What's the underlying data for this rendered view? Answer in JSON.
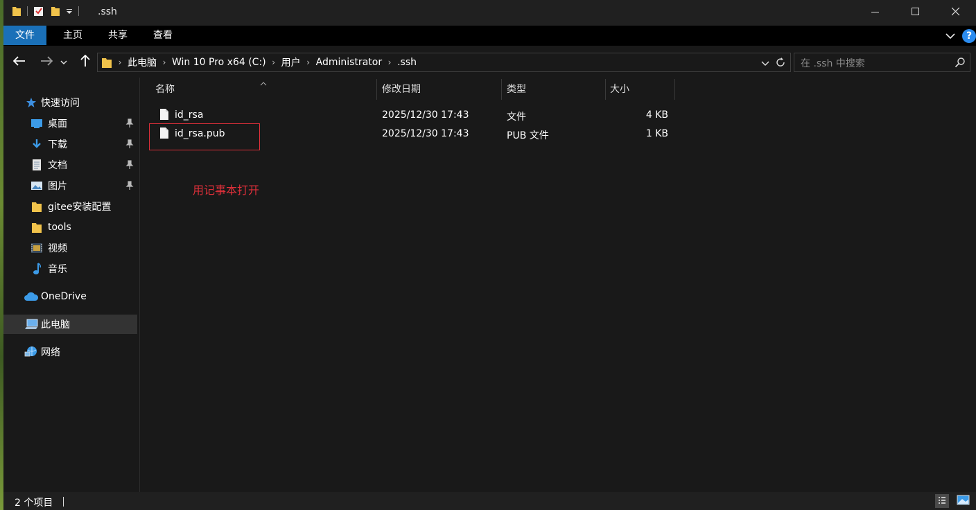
{
  "window": {
    "title": ".ssh",
    "controls": [
      "minimize-icon",
      "maximize-icon",
      "close-icon"
    ]
  },
  "ribbon": {
    "tabs": [
      {
        "label": "文件",
        "active": true
      },
      {
        "label": "主页"
      },
      {
        "label": "共享"
      },
      {
        "label": "查看"
      }
    ]
  },
  "address": {
    "crumbs": [
      "此电脑",
      "Win 10 Pro x64 (C:)",
      "用户",
      "Administrator",
      ".ssh"
    ]
  },
  "search": {
    "placeholder": "在 .ssh 中搜索"
  },
  "nav": {
    "quick_access": "快速访问",
    "items": [
      {
        "label": "桌面",
        "icon": "desktop-icon",
        "pinned": true
      },
      {
        "label": "下载",
        "icon": "download-icon",
        "pinned": true
      },
      {
        "label": "文档",
        "icon": "document-icon",
        "pinned": true
      },
      {
        "label": "图片",
        "icon": "pictures-icon",
        "pinned": true
      },
      {
        "label": "gitee安装配置",
        "icon": "folder-icon",
        "pinned": false
      },
      {
        "label": "tools",
        "icon": "folder-icon",
        "pinned": false
      },
      {
        "label": "视频",
        "icon": "videos-icon",
        "pinned": false
      },
      {
        "label": "音乐",
        "icon": "music-icon",
        "pinned": false
      }
    ],
    "onedrive": "OneDrive",
    "this_pc": "此电脑",
    "network": "网络"
  },
  "columns": {
    "name": "名称",
    "date": "修改日期",
    "type": "类型",
    "size": "大小"
  },
  "files": [
    {
      "name": "id_rsa",
      "date": "2025/12/30 17:43",
      "type": "文件",
      "size": "4 KB"
    },
    {
      "name": "id_rsa.pub",
      "date": "2025/12/30 17:43",
      "type": "PUB 文件",
      "size": "1 KB"
    }
  ],
  "annotation": "用记事本打开",
  "status": {
    "item_count": "2 个项目"
  },
  "colors": {
    "accent": "#1a70b8",
    "annotation": "#e0303a",
    "folder": "#f1c34b",
    "help": "#2b8cf0"
  }
}
